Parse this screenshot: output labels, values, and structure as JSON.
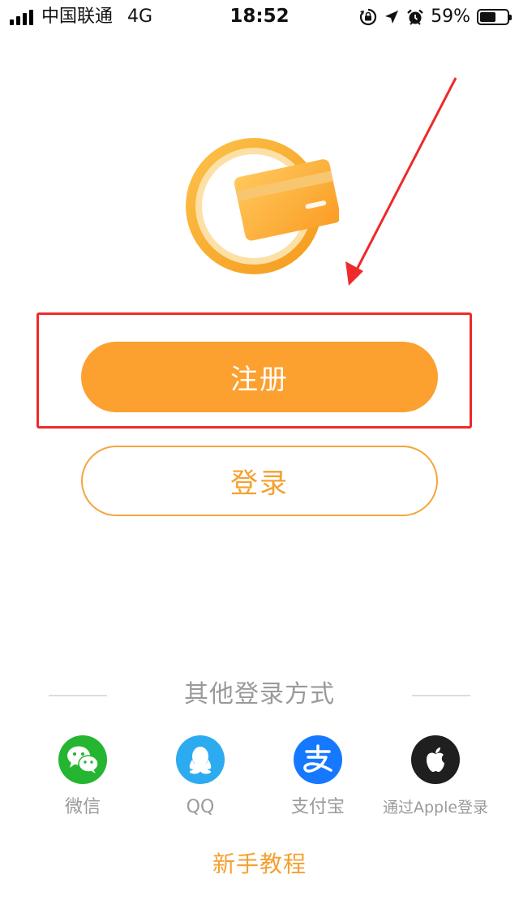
{
  "status_bar": {
    "carrier": "中国联通",
    "network": "4G",
    "time": "18:52",
    "battery_percent": "59%",
    "battery_level": 0.59,
    "icons": [
      "signal-icon",
      "orientation-lock-icon",
      "location-icon",
      "alarm-icon",
      "battery-icon"
    ]
  },
  "logo": {
    "icon": "card-coin-logo-icon"
  },
  "actions": {
    "register_label": "注册",
    "login_label": "登录"
  },
  "other_login": {
    "title": "其他登录方式",
    "providers": [
      {
        "label": "微信",
        "icon": "wechat-icon",
        "color": "#25b531"
      },
      {
        "label": "QQ",
        "icon": "qq-icon",
        "color": "#2dabf0"
      },
      {
        "label": "支付宝",
        "icon": "alipay-icon",
        "color": "#1678ff"
      },
      {
        "label": "通过Apple登录",
        "icon": "apple-icon",
        "color": "#1f1f1f"
      }
    ]
  },
  "tutorial_label": "新手教程",
  "colors": {
    "accent": "#fca030",
    "annotation": "#ee2a2a"
  }
}
